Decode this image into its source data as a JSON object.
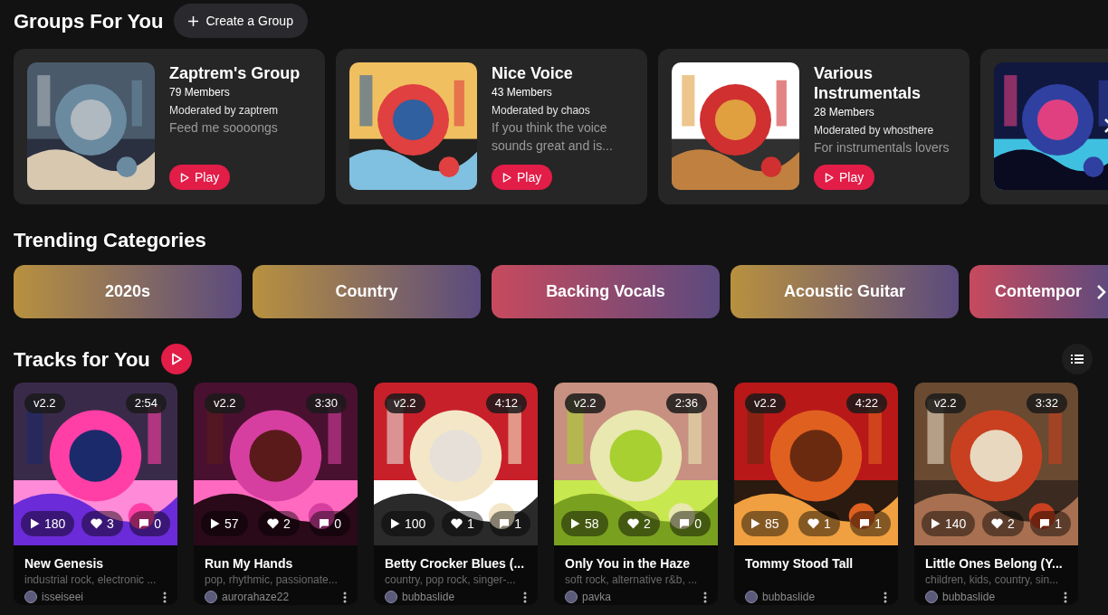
{
  "groups_section": {
    "title": "Groups For You",
    "create_button": "Create a Group"
  },
  "groups": [
    {
      "name": "Zaptrem's Group",
      "members": "79 Members",
      "moderator": "Moderated by zaptrem",
      "description": "Feed me soooongs",
      "play": "Play"
    },
    {
      "name": "Nice Voice",
      "members": "43 Members",
      "moderator": "Moderated by chaos",
      "description": "If you think the voice sounds great and is...",
      "play": "Play"
    },
    {
      "name": "Various Instrumentals",
      "members": "28 Members",
      "moderator": "Moderated by whosthere",
      "description": "For instrumentals lovers",
      "play": "Play"
    }
  ],
  "categories_section": {
    "title": "Trending Categories"
  },
  "categories": [
    {
      "label": "2020s",
      "color": "#b8913f"
    },
    {
      "label": "Country",
      "color": "#b8913f"
    },
    {
      "label": "Backing Vocals",
      "color": "#c74a5e"
    },
    {
      "label": "Acoustic Guitar",
      "color": "#b8913f"
    },
    {
      "label": "Contempor",
      "color": "#c74a5e"
    }
  ],
  "tracks_section": {
    "title": "Tracks for You"
  },
  "tracks": [
    {
      "version": "v2.2",
      "duration": "2:54",
      "plays": "180",
      "likes": "3",
      "comments": "0",
      "title": "New Genesis",
      "tags": "industrial rock, electronic ...",
      "user": "isseiseei"
    },
    {
      "version": "v2.2",
      "duration": "3:30",
      "plays": "57",
      "likes": "2",
      "comments": "0",
      "title": "Run My Hands",
      "tags": "pop, rhythmic, passionate...",
      "user": "aurorahaze22"
    },
    {
      "version": "v2.2",
      "duration": "4:12",
      "plays": "100",
      "likes": "1",
      "comments": "1",
      "title": "Betty Crocker Blues (...",
      "tags": "country, pop rock, singer-...",
      "user": "bubbaslide"
    },
    {
      "version": "v2.2",
      "duration": "2:36",
      "plays": "58",
      "likes": "2",
      "comments": "0",
      "title": "Only You in the Haze",
      "tags": "soft rock, alternative r&b, ...",
      "user": "pavka"
    },
    {
      "version": "v2.2",
      "duration": "4:22",
      "plays": "85",
      "likes": "1",
      "comments": "1",
      "title": "Tommy Stood Tall",
      "user": "bubbaslide"
    },
    {
      "version": "v2.2",
      "duration": "3:32",
      "plays": "140",
      "likes": "2",
      "comments": "1",
      "title": "Little Ones Belong (Y...",
      "tags": "children, kids, country, sin...",
      "user": "bubbaslide"
    }
  ]
}
